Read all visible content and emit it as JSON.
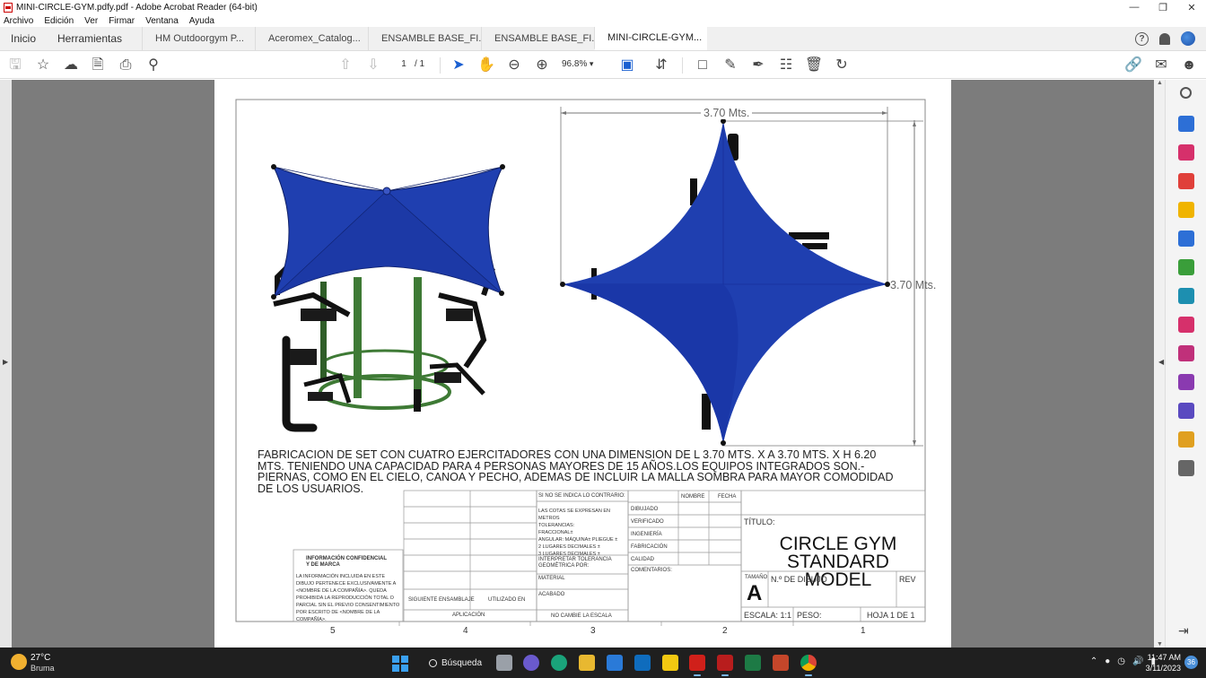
{
  "window": {
    "title": "MINI-CIRCLE-GYM.pdfy.pdf - Adobe Acrobat Reader (64-bit)",
    "controls": [
      "—",
      "❐",
      "✕"
    ]
  },
  "menu": [
    "Archivo",
    "Edición",
    "Ver",
    "Firmar",
    "Ventana",
    "Ayuda"
  ],
  "tabs": {
    "home": "Inicio",
    "tools": "Herramientas",
    "documents": [
      {
        "label": "HM Outdoorgym P...",
        "active": false
      },
      {
        "label": "Aceromex_Catalog...",
        "active": false
      },
      {
        "label": "ENSAMBLE BASE_FI...",
        "active": false
      },
      {
        "label": "ENSAMBLE BASE_FI...",
        "active": false
      },
      {
        "label": "MINI-CIRCLE-GYM...",
        "active": true
      }
    ],
    "close_glyph": "✕",
    "help_glyph": "?"
  },
  "toolbar": {
    "page_current": "1",
    "page_total": "/ 1",
    "zoom": "96.8%"
  },
  "drawing": {
    "dim_horizontal": "3.70 Mts.",
    "dim_vertical": "3.70 Mts.",
    "description": "FABRICACION DE SET CON CUATRO EJERCITADORES CON UNA DIMENSION DE L 3.70 Mts. X A 3.70 Mts. X H 6.20 Mts. TENIENDO UNA CAPACIDAD PARA 4 PERSONAS MAYORES DE 15 AÑOS.LOS EQUIPOS INTEGRADOS SON.- PIERNAS, COMO EN EL CIELO, CANOA Y PECHO, ADEMAS DE INCLUIR LA MALLA SOMBRA PARA MAYOR COMODIDAD DE LOS USUARIOS.",
    "titleblock": {
      "confidential_title": "INFORMACIÓN CONFIDENCIAL Y DE MARCA",
      "confidential_body": "LA INFORMACIÓN INCLUIDA EN ESTE DIBUJO PERTENECE EXCLUSIVAMENTE A <NOMBRE DE LA COMPAÑÍA>. QUEDA PROHIBIDA LA REPRODUCCIÓN TOTAL O PARCIAL SIN EL PREVIO CONSENTIMIENTO POR ESCRITO DE <NOMBRE DE LA COMPAÑÍA>.",
      "next_assembly": "SIGUIENTE ENSAMBLAJE",
      "used_on": "UTILIZADO EN",
      "application": "APLICACIÓN",
      "unless_noted": "SI NO SE INDICA LO CONTRARIO:",
      "dims_note": "LAS COTAS SE EXPRESAN EN METROS",
      "tolerances": "TOLERANCIAS:",
      "fractional": "FRACCIONAL±",
      "angular": "ANGULAR: MÁQUINA±     PLIEGUE ±",
      "two_decimals": "2 LUGARES DECIMALES   ±",
      "three_decimals": "3 LUGARES DECIMALES ±",
      "geom_tol": "INTERPRETAR TOLERANCIA GEOMÉTRICA POR:",
      "material": "MATERIAL",
      "finish": "ACABADO",
      "no_scale": "NO CAMBIE LA ESCALA",
      "name": "NOMBRE",
      "date": "FECHA",
      "drawn": "DIBUJADO",
      "checked": "VERIFICADO",
      "eng": "INGENIERÍA",
      "mfg": "FABRICACIÓN",
      "quality": "CALIDAD",
      "comments": "COMENTARIOS:",
      "title_label": "TÍTULO:",
      "title_line1": "CIRCLE GYM",
      "title_line2": "STANDARD MODEL",
      "size_label": "TAMAÑO",
      "size": "A",
      "drawing_no": "N.º DE DIBUJO",
      "rev": "REV",
      "scale": "ESCALA: 1:1",
      "weight": "PESO:",
      "sheet": "HOJA 1 DE 1"
    },
    "zone_numbers": [
      "5",
      "4",
      "3",
      "2",
      "1"
    ]
  },
  "taskbar": {
    "temperature": "27°C",
    "weather": "Bruma",
    "search": "Búsqueda",
    "time": "11:47 AM",
    "date": "3/11/2023",
    "notifications": "36"
  },
  "colors": {
    "canopy": "#1f3fb0",
    "canopy_dark": "#122a80",
    "frame": "#1a1a1a",
    "post": "#3e7a35",
    "workspace": "#7c7c7c"
  }
}
